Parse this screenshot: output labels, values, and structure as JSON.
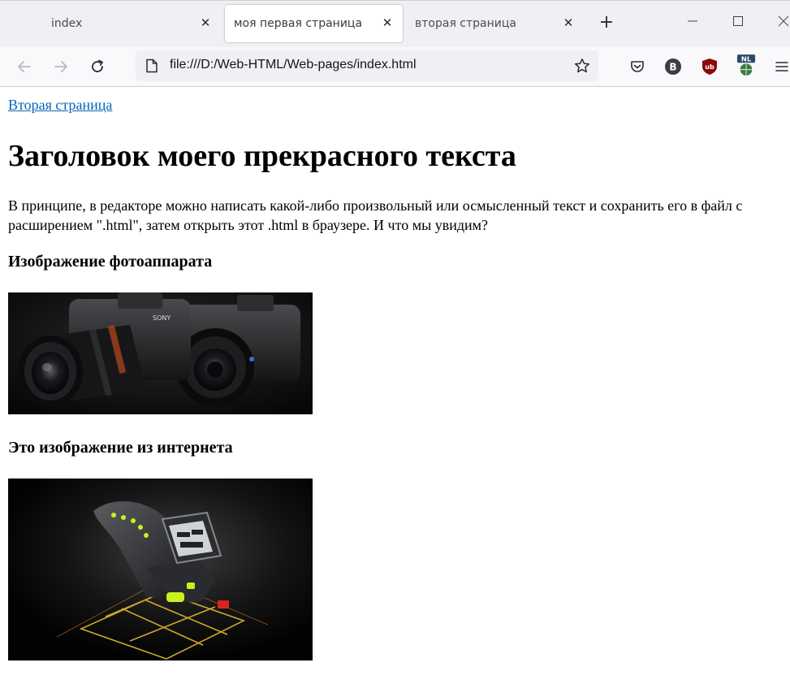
{
  "browser": {
    "tabs": [
      {
        "label": "index",
        "active": false
      },
      {
        "label": "моя первая страница",
        "active": true
      },
      {
        "label": "вторая страница",
        "active": false
      }
    ],
    "url": "file:///D:/Web-HTML/Web-pages/index.html",
    "colors": {
      "accent": "#0b64b8",
      "tabstrip": "#f0f0f4",
      "ublock": "#8a0a0a",
      "nl_badge": "#2c4a66"
    },
    "extensions": [
      {
        "icon": "pocket-icon"
      },
      {
        "icon": "b-extension-icon",
        "text": "B"
      },
      {
        "icon": "ublock-icon",
        "text": "ub"
      },
      {
        "icon": "nl-extension-icon",
        "text": "NL"
      }
    ]
  },
  "page": {
    "link": "Вторая страница",
    "heading": "Заголовок моего прекрасного текста",
    "paragraph": "В принципе, в редакторе можно написать какой-либо произвольный или осмысленный текст и сохранить его в файл с расширением \".html\", затем открыть этот .html в браузере. И что мы увидим?",
    "subheading1": "Изображение фотоаппарата",
    "image1_text": "SONY",
    "subheading2": "Это изображение из интернета"
  }
}
